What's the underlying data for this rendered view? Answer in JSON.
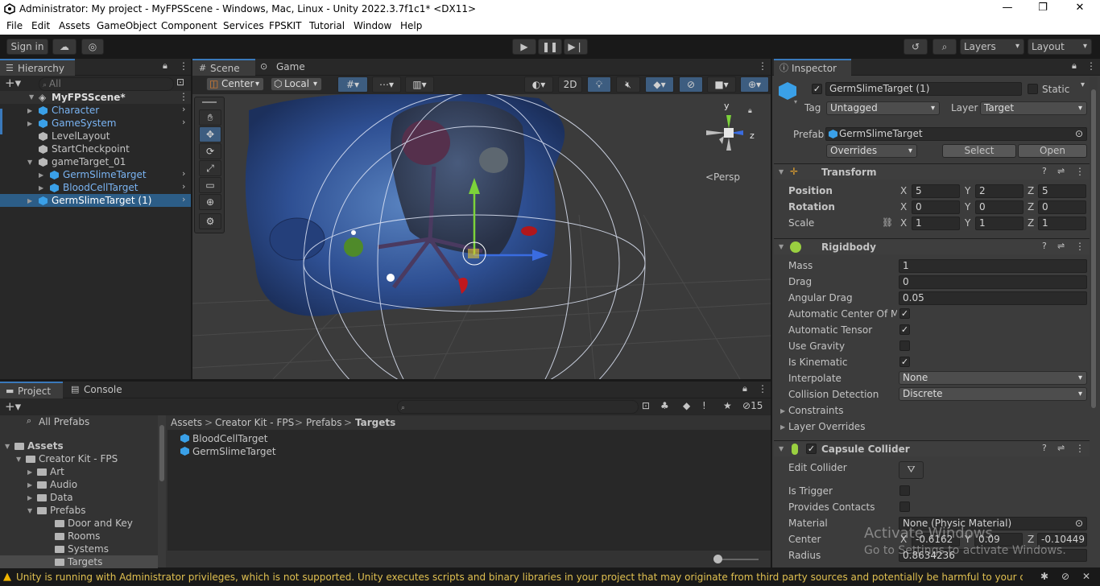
{
  "window": {
    "title": "Administrator: My project - MyFPSScene - Windows, Mac, Linux - Unity 2022.3.7f1c1* <DX11>"
  },
  "menu": [
    "File",
    "Edit",
    "Assets",
    "GameObject",
    "Component",
    "Services",
    "FPSKIT",
    "Tutorial",
    "Window",
    "Help"
  ],
  "toolbar": {
    "sign_in": "Sign in",
    "layers": "Layers",
    "layout": "Layout"
  },
  "hierarchy": {
    "tab": "Hierarchy",
    "search_placeholder": "All",
    "scene": "MyFPSScene*",
    "items": [
      {
        "label": "Character",
        "depth": 1,
        "prefab": true,
        "expandable": true
      },
      {
        "label": "GameSystem",
        "depth": 1,
        "prefab": true,
        "expandable": true
      },
      {
        "label": "LevelLayout",
        "depth": 1,
        "prefab": false,
        "expandable": false
      },
      {
        "label": "StartCheckpoint",
        "depth": 1,
        "prefab": false,
        "expandable": false
      },
      {
        "label": "gameTarget_01",
        "depth": 1,
        "prefab": false,
        "expandable": true,
        "expanded": true
      },
      {
        "label": "GermSlimeTarget",
        "depth": 2,
        "prefab": true,
        "expandable": true
      },
      {
        "label": "BloodCellTarget",
        "depth": 2,
        "prefab": true,
        "expandable": true
      },
      {
        "label": "GermSlimeTarget (1)",
        "depth": 1,
        "prefab": true,
        "expandable": true,
        "selected": true
      }
    ]
  },
  "scene_view": {
    "tabs": [
      "Scene",
      "Game"
    ],
    "pivot": "Center",
    "space": "Local",
    "mode_2d": "2D",
    "persp": "<Persp",
    "gizmo_axes": [
      "y",
      "z"
    ]
  },
  "project": {
    "tabs": [
      "Project",
      "Console"
    ],
    "hidden_count": "15",
    "favorites": [
      "All Prefabs"
    ],
    "tree": [
      {
        "label": "Assets",
        "depth": 0,
        "bold": true
      },
      {
        "label": "Creator Kit - FPS",
        "depth": 1
      },
      {
        "label": "Art",
        "depth": 2
      },
      {
        "label": "Audio",
        "depth": 2
      },
      {
        "label": "Data",
        "depth": 2
      },
      {
        "label": "Prefabs",
        "depth": 2,
        "expanded": true
      },
      {
        "label": "Door and Key",
        "depth": 3
      },
      {
        "label": "Rooms",
        "depth": 3
      },
      {
        "label": "Systems",
        "depth": 3
      },
      {
        "label": "Targets",
        "depth": 3,
        "selected": true
      }
    ],
    "breadcrumb": [
      "Assets",
      "Creator Kit - FPS",
      "Prefabs",
      "Targets"
    ],
    "files": [
      "BloodCellTarget",
      "GermSlimeTarget"
    ]
  },
  "inspector": {
    "tab": "Inspector",
    "object_name": "GermSlimeTarget (1)",
    "static_label": "Static",
    "tag_label": "Tag",
    "tag_value": "Untagged",
    "layer_label": "Layer",
    "layer_value": "Target",
    "prefab_label": "Prefab",
    "prefab_value": "GermSlimeTarget",
    "overrides": "Overrides",
    "select": "Select",
    "open": "Open",
    "transform": {
      "title": "Transform",
      "position": {
        "label": "Position",
        "x": "5",
        "y": "2",
        "z": "5"
      },
      "rotation": {
        "label": "Rotation",
        "x": "0",
        "y": "0",
        "z": "0"
      },
      "scale": {
        "label": "Scale",
        "x": "1",
        "y": "1",
        "z": "1"
      }
    },
    "rigidbody": {
      "title": "Rigidbody",
      "mass": {
        "label": "Mass",
        "value": "1"
      },
      "drag": {
        "label": "Drag",
        "value": "0"
      },
      "angular_drag": {
        "label": "Angular Drag",
        "value": "0.05"
      },
      "auto_center": {
        "label": "Automatic Center Of Ma",
        "checked": true
      },
      "auto_tensor": {
        "label": "Automatic Tensor",
        "checked": true
      },
      "use_gravity": {
        "label": "Use Gravity",
        "checked": false
      },
      "is_kinematic": {
        "label": "Is Kinematic",
        "checked": true
      },
      "interpolate": {
        "label": "Interpolate",
        "value": "None"
      },
      "collision": {
        "label": "Collision Detection",
        "value": "Discrete"
      },
      "constraints": "Constraints",
      "layer_overrides": "Layer Overrides"
    },
    "capsule": {
      "title": "Capsule Collider",
      "edit_collider": "Edit Collider",
      "is_trigger": "Is Trigger",
      "provides_contacts": "Provides Contacts",
      "material_label": "Material",
      "material_value": "None (Physic Material)",
      "center_label": "Center",
      "center": {
        "x": "-0.6162",
        "y": "0.09",
        "z": "-0.10449"
      },
      "radius_label": "Radius",
      "radius_value": "0.8634236"
    },
    "axis": {
      "x": "X",
      "y": "Y",
      "z": "Z"
    }
  },
  "watermark": {
    "line1": "Activate Windows",
    "line2": "Go to Settings to activate Windows."
  },
  "status": {
    "message": "Unity is running with Administrator privileges, which is not supported. Unity executes scripts and binary libraries in your project that may originate from third party sources and potentially be harmful to your computer. Unity ma"
  },
  "colors": {
    "accent": "#3a79bb",
    "selection": "#2c5d87",
    "prefab_blue": "#7ab4f3",
    "warning": "#f0b400"
  }
}
